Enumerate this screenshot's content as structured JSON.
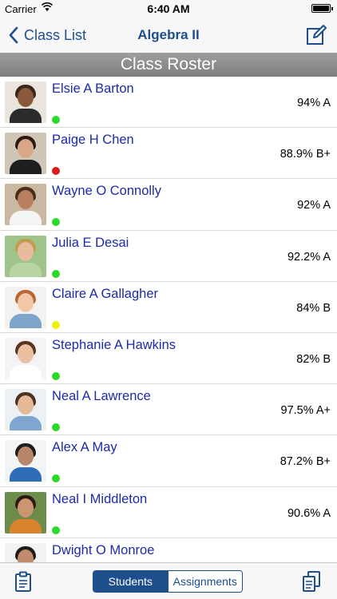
{
  "status_bar": {
    "carrier": "Carrier",
    "time": "6:40 AM"
  },
  "nav": {
    "back_label": "Class List",
    "title": "Algebra II"
  },
  "section_title": "Class Roster",
  "colors": {
    "accent": "#1f4e8c",
    "name_link": "#1c2ba8",
    "status_green": "#2bd92b",
    "status_red": "#e01b1b",
    "status_yellow": "#f2f200"
  },
  "students": [
    {
      "name": "Elsie A Barton",
      "grade": "94% A",
      "status": "green"
    },
    {
      "name": "Paige H Chen",
      "grade": "88.9% B+",
      "status": "red"
    },
    {
      "name": "Wayne O Connolly",
      "grade": "92% A",
      "status": "green"
    },
    {
      "name": "Julia E Desai",
      "grade": "92.2% A",
      "status": "green"
    },
    {
      "name": "Claire A Gallagher",
      "grade": "84% B",
      "status": "yellow"
    },
    {
      "name": "Stephanie A Hawkins",
      "grade": "82% B",
      "status": "green"
    },
    {
      "name": "Neal A Lawrence",
      "grade": "97.5% A+",
      "status": "green"
    },
    {
      "name": "Alex A May",
      "grade": "87.2% B+",
      "status": "green"
    },
    {
      "name": "Neal I Middleton",
      "grade": "90.6% A",
      "status": "green"
    },
    {
      "name": "Dwight O Monroe",
      "grade": "",
      "status": "green"
    }
  ],
  "tabs": {
    "students_label": "Students",
    "assignments_label": "Assignments",
    "selected": "Students"
  },
  "icons": {
    "back": "chevron-left-icon",
    "compose": "compose-icon",
    "clipboard": "clipboard-icon",
    "documents": "documents-icon",
    "wifi": "wifi-icon",
    "battery": "battery-icon"
  }
}
